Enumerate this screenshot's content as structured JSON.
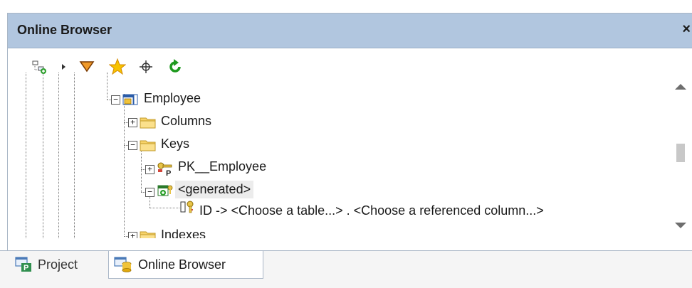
{
  "panel": {
    "title": "Online Browser",
    "close_label": "×"
  },
  "toolbar": {
    "buttons": [
      {
        "name": "connect-icon"
      },
      {
        "name": "dropdown-arrow-icon"
      },
      {
        "name": "filter-icon"
      },
      {
        "name": "favorites-star-icon"
      },
      {
        "name": "locate-crosshair-icon"
      },
      {
        "name": "refresh-icon"
      }
    ]
  },
  "tree": {
    "employee": {
      "label": "Employee",
      "expander": "−"
    },
    "columns": {
      "label": "Columns",
      "expander": "+"
    },
    "keys": {
      "label": "Keys",
      "expander": "−"
    },
    "pk": {
      "label": "PK__Employee",
      "expander": "+"
    },
    "generated": {
      "label": "<generated>",
      "expander": "−"
    },
    "fk_row": {
      "label": "ID ->  <Choose a table...> . <Choose a referenced column...>"
    },
    "indexes": {
      "label": "Indexes",
      "expander": "+"
    }
  },
  "tabs": [
    {
      "label": "Project",
      "active": false
    },
    {
      "label": "Online Browser",
      "active": true
    }
  ],
  "colors": {
    "titlebar": "#b1c6df",
    "folder": "#f5c853",
    "refresh": "#2ea12e",
    "filter": "#c8620c",
    "star": "#f2b400"
  }
}
